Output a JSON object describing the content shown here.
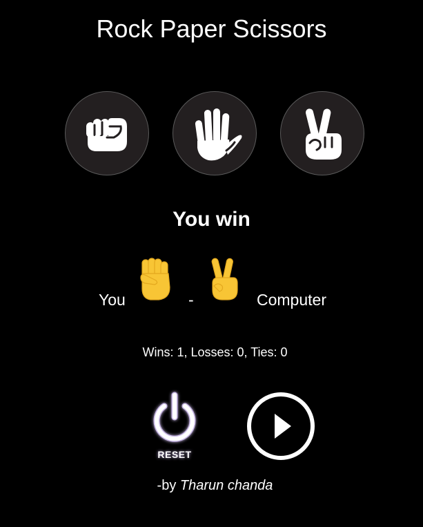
{
  "title": "Rock Paper Scissors",
  "choices": [
    {
      "name": "rock",
      "icon": "fist-icon"
    },
    {
      "name": "paper",
      "icon": "open-hand-icon"
    },
    {
      "name": "scissors",
      "icon": "victory-hand-icon"
    }
  ],
  "result": "You win",
  "matchup": {
    "you_label": "You",
    "separator": "-",
    "computer_label": "Computer",
    "you_choice_icon": "raised-fist-emoji",
    "computer_choice_icon": "victory-hand-emoji"
  },
  "score": {
    "text": "Wins: 1, Losses: 0, Ties: 0",
    "wins": 1,
    "losses": 0,
    "ties": 0
  },
  "controls": {
    "reset_label": "RESET",
    "reset_icon": "power-icon",
    "play_icon": "play-icon"
  },
  "credit": {
    "prefix": "-by ",
    "author": "Tharun chanda"
  },
  "colors": {
    "background": "#000000",
    "button_bg": "#231f20",
    "emoji_yellow": "#f8c535",
    "emoji_shade": "#e3a81e",
    "text": "#ffffff"
  }
}
